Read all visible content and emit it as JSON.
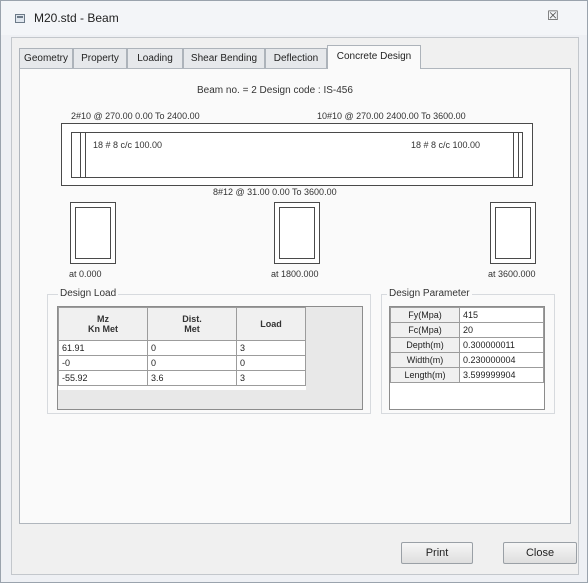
{
  "window": {
    "title": "M20.std - Beam",
    "close_glyph": "☒"
  },
  "tabs": [
    {
      "label": "Geometry"
    },
    {
      "label": "Property"
    },
    {
      "label": "Loading"
    },
    {
      "label": "Shear Bending"
    },
    {
      "label": "Deflection"
    },
    {
      "label": "Concrete Design"
    }
  ],
  "active_tab": "Concrete Design",
  "header": "Beam no. = 2  Design code :  IS-456",
  "beam": {
    "top_left_rebar": "2#10 @ 270.00 0.00 To 2400.00",
    "top_right_rebar": "10#10 @ 270.00 2400.00 To 3600.00",
    "stirrup_left": "18 # 8 c/c 100.00",
    "stirrup_right": "18 # 8 c/c 100.00",
    "bottom_rebar": "8#12 @ 31.00 0.00 To 3600.00"
  },
  "sections": [
    {
      "label": "at 0.000"
    },
    {
      "label": "at 1800.000"
    },
    {
      "label": "at 3600.000"
    }
  ],
  "design_load": {
    "title": "Design Load",
    "headers": [
      [
        "Mz",
        "Kn Met"
      ],
      [
        "Dist.",
        "Met"
      ],
      [
        "Load"
      ]
    ],
    "rows": [
      [
        "61.91",
        "0",
        "3"
      ],
      [
        "-0",
        "0",
        "0"
      ],
      [
        "-55.92",
        "3.6",
        "3"
      ]
    ]
  },
  "design_parameter": {
    "title": "Design Parameter",
    "rows": [
      [
        "Fy(Mpa)",
        "415"
      ],
      [
        "Fc(Mpa)",
        "20"
      ],
      [
        "Depth(m)",
        "0.300000011"
      ],
      [
        "Width(m)",
        "0.230000004"
      ],
      [
        "Length(m)",
        "3.599999904"
      ]
    ]
  },
  "buttons": {
    "print": "Print",
    "close": "Close"
  }
}
